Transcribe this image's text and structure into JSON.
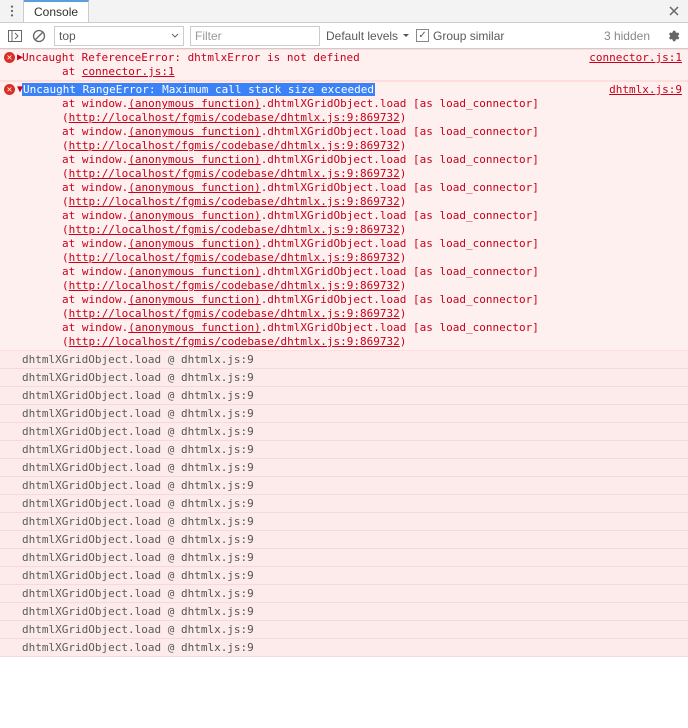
{
  "tabs": {
    "active": "Console"
  },
  "toolbar": {
    "context": "top",
    "filter_placeholder": "Filter",
    "levels": "Default levels",
    "group_similar": "Group similar",
    "hidden": "3 hidden"
  },
  "err1": {
    "title": "Uncaught ReferenceError: dhtmlxError is not defined",
    "src": "connector.js:1",
    "at": "at ",
    "at_link": "connector.js:1"
  },
  "err2": {
    "title": "Uncaught RangeError: Maximum call stack size exceeded",
    "src": "dhtmlx.js:9",
    "frame_prefix": "at window.",
    "anon": "(anonymous function)",
    "frame_mid": ".dhtmlXGridObject.load [as load_connector] (",
    "url": "http://localhost/fgmis/codebase/dhtmlx.js:9:869732",
    "frame_end": ")"
  },
  "load_row": {
    "text": "dhtmlXGridObject.load @ ",
    "link": "dhtmlx.js:9"
  },
  "repeat_frames": 9,
  "repeat_loads": 17
}
